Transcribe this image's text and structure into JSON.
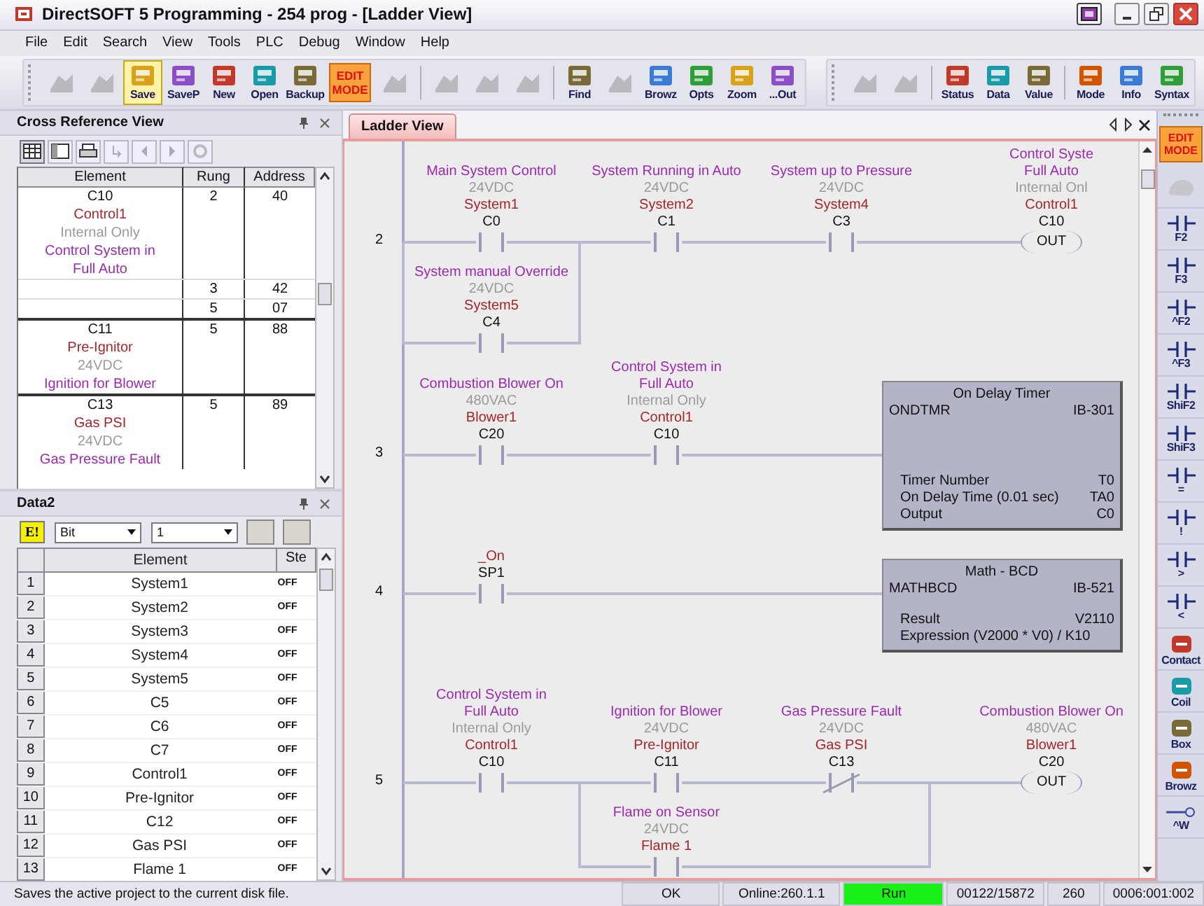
{
  "window": {
    "title": "DirectSOFT 5 Programming - 254 prog - [Ladder View]"
  },
  "menu": [
    "File",
    "Edit",
    "Search",
    "View",
    "Tools",
    "PLC",
    "Debug",
    "Window",
    "Help"
  ],
  "toolbars": [
    {
      "groups": [
        [
          {
            "kind": "disabled",
            "active": false
          },
          {
            "kind": "disabled",
            "active": false
          },
          {
            "kind": "button",
            "label": "Save",
            "active": true
          },
          {
            "kind": "button",
            "label": "SaveP",
            "active": false
          },
          {
            "kind": "button",
            "label": "New",
            "active": false
          },
          {
            "kind": "button",
            "label": "Open",
            "active": false
          },
          {
            "kind": "button",
            "label": "Backup",
            "active": false
          },
          {
            "kind": "edit",
            "label": "EDIT MODE",
            "active": false
          },
          {
            "kind": "disabled",
            "active": false
          }
        ],
        [
          {
            "kind": "disabled",
            "active": false
          },
          {
            "kind": "disabled",
            "active": false
          },
          {
            "kind": "disabled",
            "active": false
          }
        ],
        [
          {
            "kind": "button",
            "label": "Find",
            "active": false
          },
          {
            "kind": "disabled",
            "active": false
          },
          {
            "kind": "button",
            "label": "Browz",
            "active": false
          },
          {
            "kind": "button",
            "label": "Opts",
            "active": false
          },
          {
            "kind": "button",
            "label": "Zoom",
            "active": false
          },
          {
            "kind": "button",
            "label": "...Out",
            "active": false
          }
        ]
      ]
    },
    {
      "groups": [
        [
          {
            "kind": "disabled",
            "active": false
          },
          {
            "kind": "disabled",
            "active": false
          }
        ],
        [
          {
            "kind": "button",
            "label": "Status",
            "active": false
          },
          {
            "kind": "button",
            "label": "Data",
            "active": false
          },
          {
            "kind": "button",
            "label": "Value",
            "active": false
          }
        ],
        [
          {
            "kind": "button",
            "label": "Mode",
            "active": false
          },
          {
            "kind": "button",
            "label": "Info",
            "active": false
          },
          {
            "kind": "button",
            "label": "Syntax",
            "active": false
          }
        ]
      ]
    }
  ],
  "cross_reference": {
    "title": "Cross Reference View",
    "columns": [
      "Element",
      "Rung",
      "Address"
    ],
    "entries": [
      {
        "address": "C10",
        "nickname": "Control1",
        "wiring": "Internal Only",
        "description_lines": [
          "Control System in",
          "Full Auto"
        ],
        "refs": [
          {
            "rung": "2",
            "address": "40"
          },
          {
            "rung": "3",
            "address": "42"
          },
          {
            "rung": "5",
            "address": "07"
          }
        ]
      },
      {
        "address": "C11",
        "nickname": "Pre-Ignitor",
        "wiring": "24VDC",
        "description_lines": [
          "Ignition for Blower"
        ],
        "refs": [
          {
            "rung": "5",
            "address": "88"
          }
        ]
      },
      {
        "address": "C13",
        "nickname": "Gas PSI",
        "wiring": "24VDC",
        "description_lines": [
          "Gas Pressure Fault"
        ],
        "refs": [
          {
            "rung": "5",
            "address": "89"
          }
        ]
      }
    ]
  },
  "data_view": {
    "title": "Data2",
    "mode_button": "E!",
    "type_select": "Bit",
    "count_select": "1",
    "columns": [
      "Element",
      "Ste"
    ],
    "rows": [
      {
        "number": "1",
        "element": "System1",
        "state": "OFF"
      },
      {
        "number": "2",
        "element": "System2",
        "state": "OFF"
      },
      {
        "number": "3",
        "element": "System3",
        "state": "OFF"
      },
      {
        "number": "4",
        "element": "System4",
        "state": "OFF"
      },
      {
        "number": "5",
        "element": "System5",
        "state": "OFF"
      },
      {
        "number": "6",
        "element": "C5",
        "state": "OFF"
      },
      {
        "number": "7",
        "element": "C6",
        "state": "OFF"
      },
      {
        "number": "8",
        "element": "C7",
        "state": "OFF"
      },
      {
        "number": "9",
        "element": "Control1",
        "state": "OFF"
      },
      {
        "number": "10",
        "element": "Pre-Ignitor",
        "state": "OFF"
      },
      {
        "number": "11",
        "element": "C12",
        "state": "OFF"
      },
      {
        "number": "12",
        "element": "Gas PSI",
        "state": "OFF"
      },
      {
        "number": "13",
        "element": "Flame 1",
        "state": "OFF"
      }
    ]
  },
  "ladder": {
    "tab": "Ladder View",
    "rungs": [
      {
        "number": "2",
        "elements": [
          {
            "kind": "branch",
            "paths": [
              [
                {
                  "kind": "no",
                  "address": "C0",
                  "nickname": "System1",
                  "wiring": "24VDC",
                  "description_lines": [
                    "Main System Control"
                  ]
                }
              ],
              [
                {
                  "kind": "no",
                  "address": "C4",
                  "nickname": "System5",
                  "wiring": "24VDC",
                  "description_lines": [
                    "System manual Override"
                  ]
                }
              ]
            ]
          },
          {
            "kind": "no",
            "address": "C1",
            "nickname": "System2",
            "wiring": "24VDC",
            "description_lines": [
              "System Running in Auto"
            ]
          },
          {
            "kind": "no",
            "address": "C3",
            "nickname": "System4",
            "wiring": "24VDC",
            "description_lines": [
              "System up to Pressure"
            ]
          },
          {
            "kind": "coil",
            "address": "C10",
            "instruction": "OUT",
            "nickname": "Control1",
            "wiring": "Internal Onl",
            "description_lines": [
              "Control Syste",
              "Full Auto"
            ]
          }
        ]
      },
      {
        "number": "3",
        "elements": [
          {
            "kind": "no",
            "address": "C20",
            "nickname": "Blower1",
            "wiring": "480VAC",
            "description_lines": [
              "Combustion Blower On"
            ]
          },
          {
            "kind": "no",
            "address": "C10",
            "nickname": "Control1",
            "wiring": "Internal Only",
            "description_lines": [
              "Control System in",
              "Full Auto"
            ]
          },
          {
            "kind": "timer",
            "title": "On Delay Timer",
            "name": "ONDTMR",
            "id": "IB-301",
            "params": [
              {
                "label": "Timer Number",
                "value": "T0"
              },
              {
                "label": "On Delay Time (0.01 sec)",
                "value": "TA0"
              },
              {
                "label": "Output",
                "value": "C0"
              }
            ]
          }
        ]
      },
      {
        "number": "4",
        "elements": [
          {
            "kind": "no",
            "address": "SP1",
            "nickname": "_On"
          },
          {
            "kind": "math",
            "title": "Math - BCD",
            "name": "MATHBCD",
            "id": "IB-521",
            "params": [
              {
                "label": "Result",
                "value": "V2110"
              },
              {
                "label": "Expression  (V2000 * V0) / K10"
              }
            ]
          }
        ]
      },
      {
        "number": "5",
        "elements": [
          {
            "kind": "no",
            "address": "C10",
            "nickname": "Control1",
            "wiring": "Internal Only",
            "description_lines": [
              "Control System in",
              "Full Auto"
            ]
          },
          {
            "kind": "branch",
            "paths": [
              [
                {
                  "kind": "no",
                  "address": "C11",
                  "nickname": "Pre-Ignitor",
                  "wiring": "24VDC",
                  "description_lines": [
                    "Ignition for Blower"
                  ]
                },
                {
                  "kind": "nc",
                  "address": "C13",
                  "nickname": "Gas PSI",
                  "wiring": "24VDC",
                  "description_lines": [
                    "Gas Pressure Fault"
                  ]
                }
              ],
              [
                {
                  "kind": "no",
                  "nickname": "Flame 1",
                  "wiring": "24VDC",
                  "description_lines": [
                    "Flame on Sensor"
                  ]
                }
              ]
            ]
          },
          {
            "kind": "coil",
            "address": "C20",
            "instruction": "OUT",
            "nickname": "Blower1",
            "wiring": "480VAC",
            "description_lines": [
              "Combustion Blower On"
            ]
          }
        ]
      }
    ]
  },
  "palette": [
    {
      "kind": "edit",
      "label": "EDIT MODE"
    },
    {
      "kind": "disabled"
    },
    {
      "kind": "instruction",
      "label": "F2"
    },
    {
      "kind": "instruction",
      "label": "F3"
    },
    {
      "kind": "instruction",
      "label": "^F2"
    },
    {
      "kind": "instruction",
      "label": "^F3"
    },
    {
      "kind": "instruction",
      "label": "ShiF2"
    },
    {
      "kind": "instruction",
      "label": "ShiF3"
    },
    {
      "kind": "instruction",
      "label": "="
    },
    {
      "kind": "instruction",
      "label": "!"
    },
    {
      "kind": "instruction",
      "label": ">"
    },
    {
      "kind": "instruction",
      "label": "<"
    },
    {
      "kind": "tool",
      "label": "Contact"
    },
    {
      "kind": "tool",
      "label": "Coil"
    },
    {
      "kind": "tool",
      "label": "Box"
    },
    {
      "kind": "tool",
      "label": "Browz"
    },
    {
      "kind": "line",
      "label": "^W"
    }
  ],
  "status_bar": [
    {
      "kind": "message",
      "text": "Saves the active project to the current disk file."
    },
    {
      "kind": "field",
      "text": "OK"
    },
    {
      "kind": "field",
      "text": "Online:260.1.1"
    },
    {
      "kind": "run",
      "text": "Run"
    },
    {
      "kind": "field",
      "text": "00122/15872"
    },
    {
      "kind": "field",
      "text": "260"
    },
    {
      "kind": "field",
      "text": "0006:001:002"
    }
  ]
}
